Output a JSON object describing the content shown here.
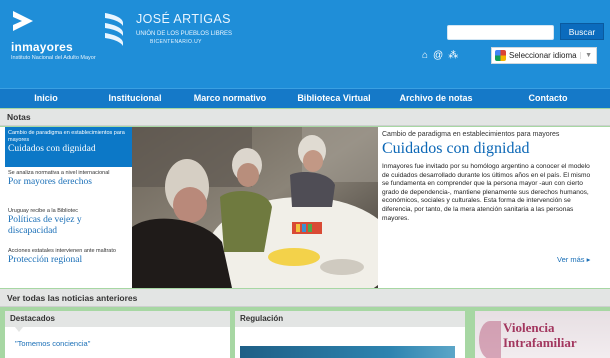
{
  "header": {
    "logo_title": "inmayores",
    "logo_subtitle": "Instituto Nacional del Adulto Mayor",
    "artigas_name": "JOSÉ ARTIGAS",
    "artigas_line1": "UNIÓN DE LOS PUEBLOS LIBRES",
    "artigas_line2": "BICENTENARIO.UY",
    "search_placeholder": "",
    "search_button": "Buscar",
    "icons": [
      "home-icon",
      "at-icon",
      "sitemap-icon"
    ],
    "language_select": "Seleccionar idioma",
    "language_arrow": "▼"
  },
  "nav": {
    "items": [
      "Inicio",
      "Institucional",
      "Marco normativo",
      "Biblioteca Virtual",
      "Archivo de notas",
      "Contacto"
    ]
  },
  "notas": {
    "section_title": "Notas",
    "items": [
      {
        "small": "Cambio de paradigma en establecimientos para mayores",
        "big": "Cuidados con dignidad"
      },
      {
        "small": "Se analiza normativa a nivel internacional",
        "big": "Por mayores derechos"
      },
      {
        "small": "Uruguay recibe a la Bibliotec",
        "big": "Políticas de vejez y discapacidad"
      },
      {
        "small": "Acciones estatales intervienen ante maltrato",
        "big": "Protección regional"
      }
    ],
    "feature": {
      "kicker": "Cambio de paradigma en establecimientos para mayores",
      "title": "Cuidados con dignidad",
      "body": "Inmayores fue invitado por su homólogo argentino a conocer el modelo de cuidados desarrollado durante los últimos años en el país. El mismo se fundamenta en comprender que la persona mayor -aun con cierto grado de dependencia-, mantiene plenamente sus derechos humanos, económicos, sociales y culturales. Esta forma de intervención se diferencia, por tanto, de la mera atención sanitaria a las personas mayores.",
      "more": "Ver más ▸"
    },
    "all_news": "Ver todas las noticias anteriores"
  },
  "bottom": {
    "destacados_title": "Destacados",
    "destacados_item": "\"Tomemos conciencia\"",
    "regulacion_title": "Regulación",
    "banner_line1": "Violencia",
    "banner_line2": "Intrafamiliar"
  },
  "colors": {
    "header_blue": "#1f8ed8",
    "nav_blue": "#1579c8",
    "link_blue": "#1a6fb7",
    "page_green": "#a7d7a3",
    "banner_magenta": "#a3375f"
  }
}
